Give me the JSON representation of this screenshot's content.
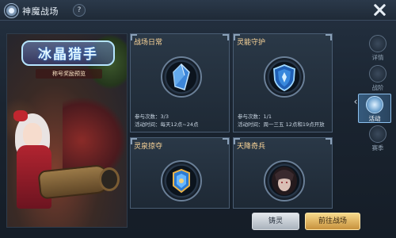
{
  "header": {
    "title": "神魔战场",
    "help_label": "?"
  },
  "promo": {
    "title": "冰晶猎手",
    "subtitle": "称号奖励预览"
  },
  "cards": [
    {
      "title": "战场日常",
      "icon": "blue-crystal-icon",
      "attempts_label": "参与次数：",
      "attempts_value": "3/3",
      "time_label": "活动时间：",
      "time_value": "每天12点~24点"
    },
    {
      "title": "灵能守护",
      "icon": "blue-shield-icon",
      "attempts_label": "参与次数：",
      "attempts_value": "1/1",
      "time_label": "活动时间：",
      "time_value": "周一三五 12点和19点开放"
    },
    {
      "title": "灵泉掠夺",
      "icon": "blue-gold-emblem-icon"
    },
    {
      "title": "天降奇兵",
      "icon": "dark-warrior-portrait-icon"
    }
  ],
  "tabs": [
    {
      "label": "详情",
      "icon": "details-icon"
    },
    {
      "label": "战阶",
      "icon": "rank-icon"
    },
    {
      "label": "活动",
      "icon": "activity-icon",
      "active": true
    },
    {
      "label": "赛季",
      "icon": "season-icon"
    }
  ],
  "buttons": {
    "forge": "铸灵",
    "go_battlefield": "前往战场"
  },
  "colors": {
    "card_title": "#ffd89a",
    "accent_blue": "#8cc0ee",
    "gold_button": "#e0b25e"
  }
}
